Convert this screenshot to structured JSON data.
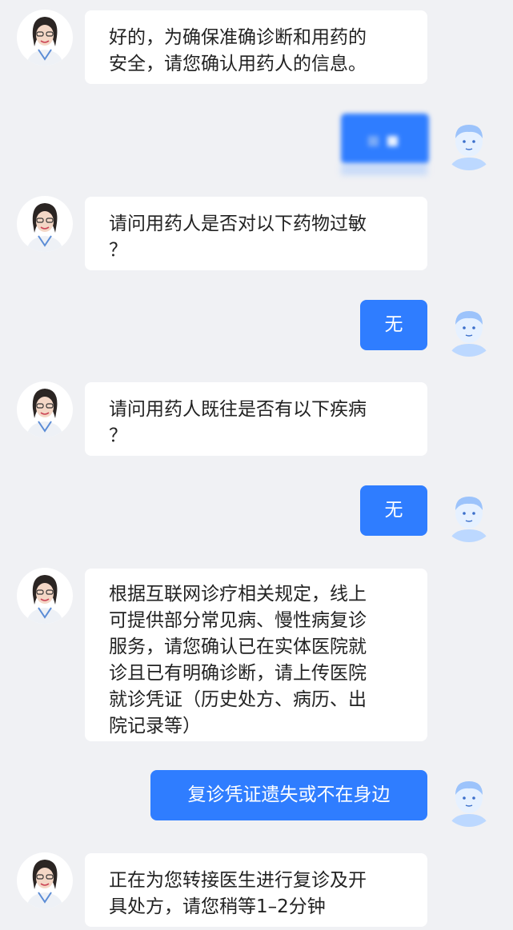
{
  "conversation": {
    "messages": [
      {
        "sender": "doctor",
        "lines": [
          "好的，为确保准确诊断和用药的",
          "安全，请您确认用药人的信息。"
        ]
      },
      {
        "sender": "user",
        "redacted": true
      },
      {
        "sender": "doctor",
        "lines": [
          "请问用药人是否对以下药物过敏",
          "？"
        ]
      },
      {
        "sender": "user",
        "text": "无"
      },
      {
        "sender": "doctor",
        "lines": [
          "请问用药人既往是否有以下疾病",
          "？"
        ]
      },
      {
        "sender": "user",
        "text": "无"
      },
      {
        "sender": "doctor",
        "lines": [
          "根据互联网诊疗相关规定，线上",
          "可提供部分常见病、慢性病复诊",
          "服务，请您确认已在实体医院就",
          "诊且已有明确诊断，请上传医院",
          "就诊凭证（历史处方、病历、出",
          "院记录等）"
        ]
      },
      {
        "sender": "user",
        "text": "复诊凭证遗失或不在身边"
      },
      {
        "sender": "doctor",
        "lines": [
          "正在为您转接医生进行复诊及开",
          "具处方，请您稍等1–2分钟"
        ]
      }
    ]
  },
  "colors": {
    "background": "#f0f1f4",
    "doctor_bubble": "#ffffff",
    "user_bubble": "#2f7dff",
    "user_avatar": "#cfe3ff"
  },
  "icons": {
    "doctor_avatar": "doctor-avatar-icon",
    "user_avatar": "user-avatar-icon"
  }
}
